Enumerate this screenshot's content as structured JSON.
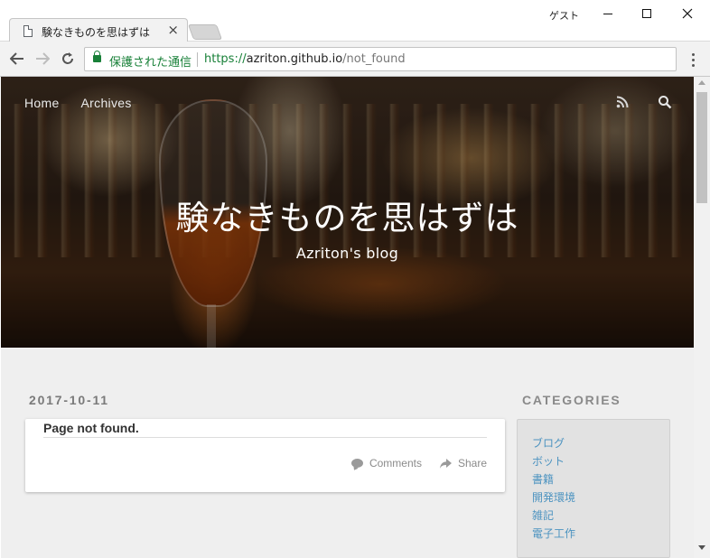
{
  "browser": {
    "tab_title": "験なきものを思はずは",
    "guest_label": "ゲスト",
    "secure_label": "保護された通信",
    "url_scheme": "https://",
    "url_host": "azriton.github.io",
    "url_path": "/not_found"
  },
  "site": {
    "nav": [
      "Home",
      "Archives"
    ],
    "title": "験なきものを思はずは",
    "subtitle": "Azriton's blog"
  },
  "post": {
    "date": "2017-10-11",
    "title": "Page not found.",
    "comments_label": "Comments",
    "share_label": "Share"
  },
  "sidebar": {
    "heading": "CATEGORIES",
    "categories": [
      "ブログ",
      "ボット",
      "書籍",
      "開発環境",
      "雑記",
      "電子工作"
    ]
  },
  "colors": {
    "secure_green": "#188038",
    "link_blue": "#4c93c0",
    "page_bg": "#efefef"
  }
}
